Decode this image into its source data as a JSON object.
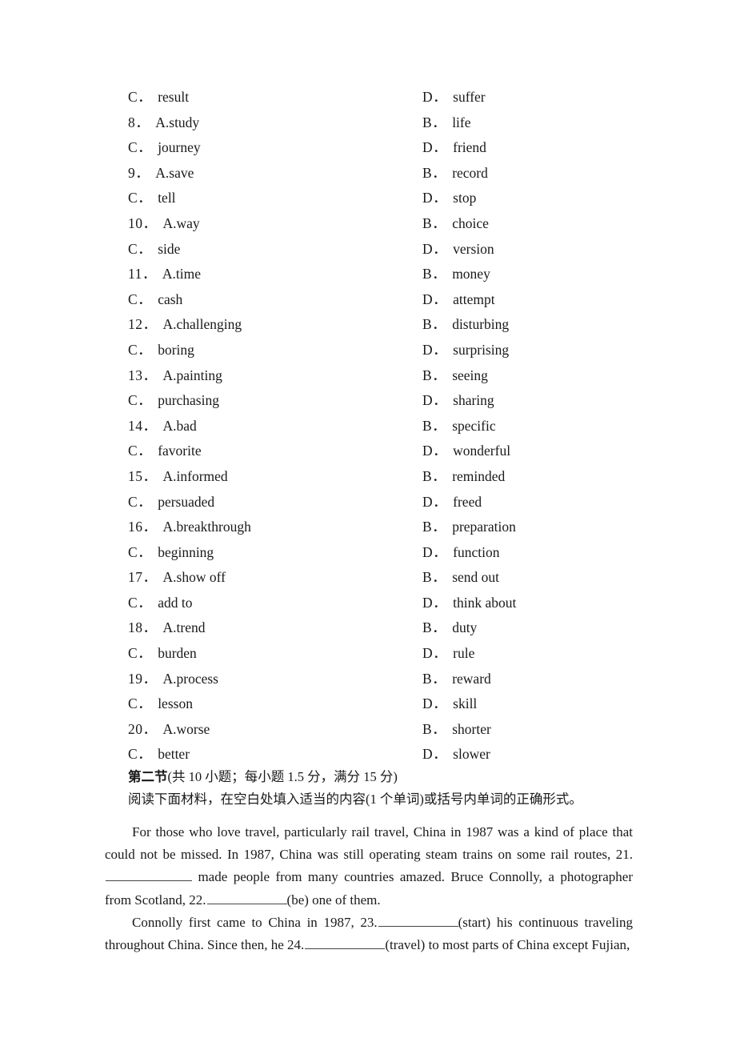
{
  "document": {
    "type": "english-exam-paper",
    "page_background": "#ffffff",
    "text_color": "#1a1a1a"
  },
  "cloze_options": {
    "rows": [
      {
        "left": {
          "key": "C．",
          "text": "result"
        },
        "right": {
          "key": "D．",
          "text": "suffer"
        }
      },
      {
        "left": {
          "key": "8．",
          "text": "A.study"
        },
        "right": {
          "key": "B．",
          "text": "life"
        }
      },
      {
        "left": {
          "key": "C．",
          "text": "journey"
        },
        "right": {
          "key": "D．",
          "text": "friend"
        }
      },
      {
        "left": {
          "key": "9．",
          "text": "A.save"
        },
        "right": {
          "key": "B．",
          "text": "record"
        }
      },
      {
        "left": {
          "key": "C．",
          "text": "tell"
        },
        "right": {
          "key": "D．",
          "text": "stop"
        }
      },
      {
        "left": {
          "key": "10．",
          "text": "A.way"
        },
        "right": {
          "key": "B．",
          "text": "choice"
        }
      },
      {
        "left": {
          "key": "C．",
          "text": "side"
        },
        "right": {
          "key": "D．",
          "text": "version"
        }
      },
      {
        "left": {
          "key": "11．",
          "text": "A.time"
        },
        "right": {
          "key": "B．",
          "text": "money"
        }
      },
      {
        "left": {
          "key": "C．",
          "text": "cash"
        },
        "right": {
          "key": "D．",
          "text": "attempt"
        }
      },
      {
        "left": {
          "key": "12．",
          "text": "A.challenging"
        },
        "right": {
          "key": "B．",
          "text": "disturbing"
        }
      },
      {
        "left": {
          "key": "C．",
          "text": "boring"
        },
        "right": {
          "key": "D．",
          "text": "surprising"
        }
      },
      {
        "left": {
          "key": "13．",
          "text": "A.painting"
        },
        "right": {
          "key": "B．",
          "text": "seeing"
        }
      },
      {
        "left": {
          "key": "C．",
          "text": "purchasing"
        },
        "right": {
          "key": "D．",
          "text": "sharing"
        }
      },
      {
        "left": {
          "key": "14．",
          "text": "A.bad"
        },
        "right": {
          "key": "B．",
          "text": "specific"
        }
      },
      {
        "left": {
          "key": "C．",
          "text": "favorite"
        },
        "right": {
          "key": "D．",
          "text": "wonderful"
        }
      },
      {
        "left": {
          "key": "15．",
          "text": "A.informed"
        },
        "right": {
          "key": "B．",
          "text": "reminded"
        }
      },
      {
        "left": {
          "key": "C．",
          "text": "persuaded"
        },
        "right": {
          "key": "D．",
          "text": "freed"
        }
      },
      {
        "left": {
          "key": "16．",
          "text": "A.breakthrough"
        },
        "right": {
          "key": "B．",
          "text": "preparation"
        }
      },
      {
        "left": {
          "key": "C．",
          "text": "beginning"
        },
        "right": {
          "key": "D．",
          "text": "function"
        }
      },
      {
        "left": {
          "key": "17．",
          "text": "A.show off"
        },
        "right": {
          "key": "B．",
          "text": "send out"
        }
      },
      {
        "left": {
          "key": "C．",
          "text": "add to"
        },
        "right": {
          "key": "D．",
          "text": "think about"
        }
      },
      {
        "left": {
          "key": "18．",
          "text": "A.trend"
        },
        "right": {
          "key": "B．",
          "text": "duty"
        }
      },
      {
        "left": {
          "key": "C．",
          "text": "burden"
        },
        "right": {
          "key": "D．",
          "text": "rule"
        }
      },
      {
        "left": {
          "key": "19．",
          "text": "A.process"
        },
        "right": {
          "key": "B．",
          "text": "reward"
        }
      },
      {
        "left": {
          "key": "C．",
          "text": "lesson"
        },
        "right": {
          "key": "D．",
          "text": "skill"
        }
      },
      {
        "left": {
          "key": "20．",
          "text": "A.worse"
        },
        "right": {
          "key": "B．",
          "text": "shorter"
        }
      },
      {
        "left": {
          "key": "C．",
          "text": "better"
        },
        "right": {
          "key": "D．",
          "text": "slower"
        }
      }
    ]
  },
  "section_two": {
    "heading_bold": "第二节",
    "heading_rest": "(共 10 小题；每小题 1.5 分，满分 15 分)",
    "instruction": "阅读下面材料，在空白处填入适当的内容(1 个单词)或括号内单词的正确形式。"
  },
  "passage": {
    "paragraph_1_part_1": "For those who love travel, particularly rail travel, China in 1987 was a kind of place that could not be missed. In 1987, China was still operating steam trains on some rail routes, 21.",
    "paragraph_1_part_2": "made people from many countries amazed. Bruce Connolly, a photographer from Scotland, 22.",
    "paragraph_1_part_3": "(be) one of them.",
    "paragraph_2_part_1": "Connolly first came to China in 1987, 23.",
    "paragraph_2_part_2": "(start) his continuous traveling throughout China. Since then, he 24.",
    "paragraph_2_part_3": "(travel) to most parts of China except Fujian,"
  }
}
